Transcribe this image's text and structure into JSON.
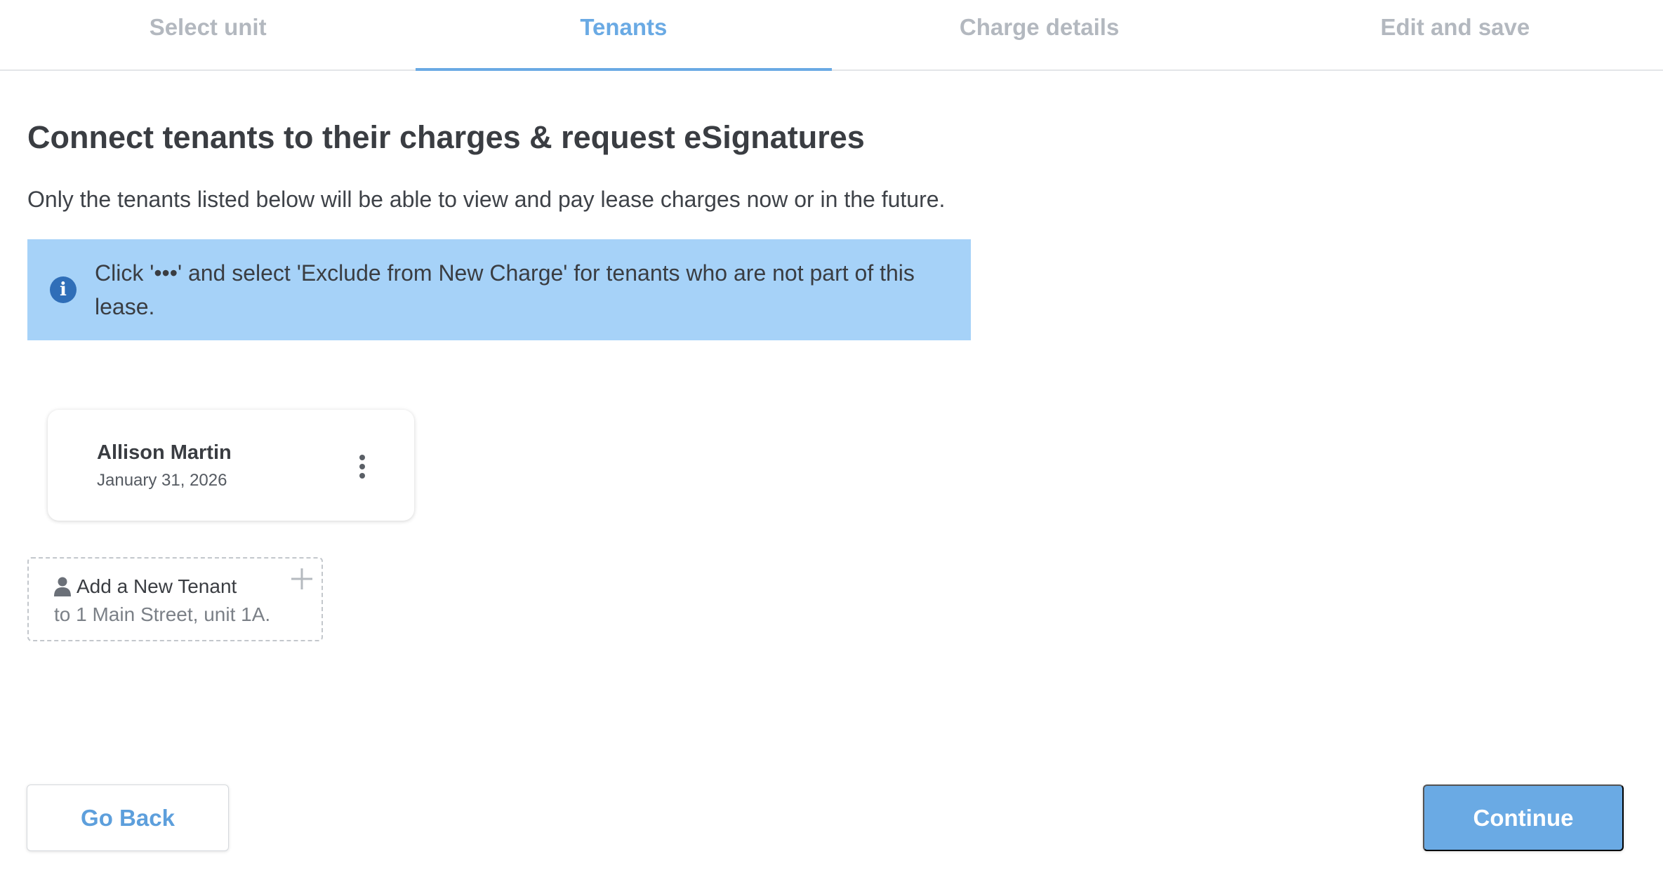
{
  "stepper": {
    "steps": [
      {
        "label": "Select unit",
        "active": false
      },
      {
        "label": "Tenants",
        "active": true
      },
      {
        "label": "Charge details",
        "active": false
      },
      {
        "label": "Edit and save",
        "active": false
      }
    ]
  },
  "page": {
    "title": "Connect tenants to their charges & request eSignatures",
    "subtitle": "Only the tenants listed below will be able to view and pay lease charges now or in the future."
  },
  "info_banner": {
    "icon": "info-icon",
    "text": "Click '•••' and select 'Exclude from New Charge' for tenants who are not part of this lease."
  },
  "tenants": [
    {
      "name": "Allison Martin",
      "date": "January 31, 2026",
      "menu_icon": "more-vertical-icon"
    }
  ],
  "add_tenant": {
    "title": "Add a New Tenant",
    "subtitle": "to 1 Main Street, unit 1A.",
    "icons": [
      "person-icon",
      "plus-icon"
    ]
  },
  "footer": {
    "back_label": "Go Back",
    "continue_label": "Continue"
  },
  "colors": {
    "accent": "#6aaae4",
    "banner_bg": "#a6d2f8",
    "info_icon": "#2f6eb8",
    "inactive_step": "#b3b8bf"
  }
}
